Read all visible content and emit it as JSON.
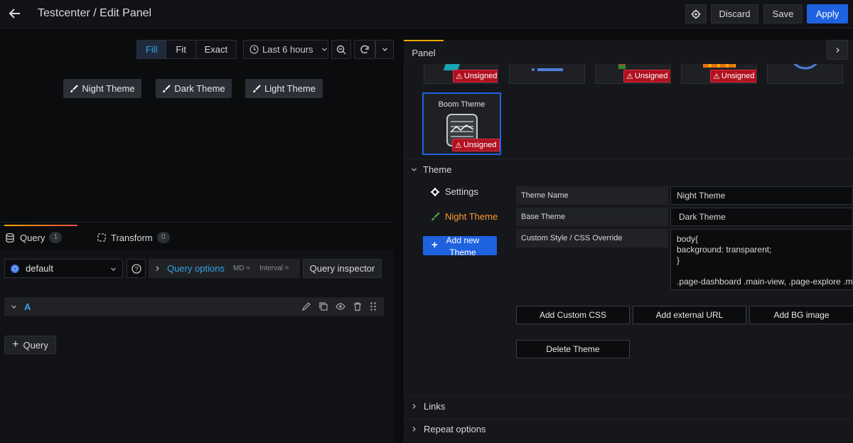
{
  "header": {
    "title": "Testcenter / Edit Panel",
    "discard_label": "Discard",
    "save_label": "Save",
    "apply_label": "Apply"
  },
  "view_mode": {
    "options": [
      "Fill",
      "Fit",
      "Exact"
    ],
    "selected": "Fill"
  },
  "time_picker": {
    "label": "Last 6 hours"
  },
  "theme_buttons": [
    "Night Theme",
    "Dark Theme",
    "Light Theme"
  ],
  "query_tabs": [
    {
      "label": "Query",
      "count": "1"
    },
    {
      "label": "Transform",
      "count": "0"
    }
  ],
  "query_row": {
    "datasource": "default",
    "options_label": "Query options",
    "md": "MD =",
    "interval": "Interval =",
    "inspector_label": "Query inspector"
  },
  "query_a": {
    "label": "A"
  },
  "add_query_label": "Query",
  "panel_tab": {
    "label": "Panel"
  },
  "plugin_cards": {
    "unsigned_label": "Unsigned",
    "boom_title": "Boom Theme"
  },
  "theme_section": {
    "title": "Theme",
    "nav": {
      "settings": "Settings",
      "night": "Night Theme",
      "add_new": [
        "Add new",
        "Theme"
      ]
    },
    "fields": {
      "theme_name_label": "Theme Name",
      "theme_name_value": "Night Theme",
      "base_theme_label": "Base Theme",
      "base_theme_value": "Dark Theme",
      "css_label": "Custom Style / CSS Override",
      "css_lines": [
        "body{",
        "background: transparent;",
        "}",
        "",
        ".page-dashboard .main-view, .page-explore .mai"
      ]
    },
    "actions": {
      "add_css": "Add Custom CSS",
      "add_url": "Add external URL",
      "add_bg": "Add BG image",
      "delete": "Delete Theme"
    }
  },
  "sections": {
    "links": "Links",
    "repeat": "Repeat options"
  },
  "colors": {
    "accent_blue": "#1f62e0",
    "unsigned_red": "#b0111f",
    "active_orange": "#ff9830",
    "link_blue": "#33a2e5"
  }
}
